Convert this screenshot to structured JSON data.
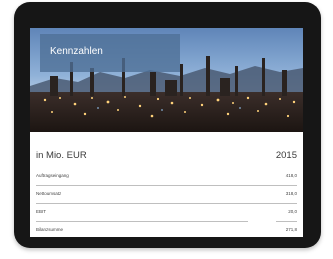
{
  "hero": {
    "title": "Kennzahlen"
  },
  "table": {
    "header_label": "in Mio. EUR",
    "header_year": "2015",
    "rows": [
      {
        "label": "Auftragseingang",
        "value": "418,0"
      },
      {
        "label": "Nettoumsatz",
        "value": "318,0"
      },
      {
        "label": "EBIT",
        "value": "20,0"
      },
      {
        "label": "Bilanzsumme",
        "value": "271,8"
      }
    ]
  }
}
